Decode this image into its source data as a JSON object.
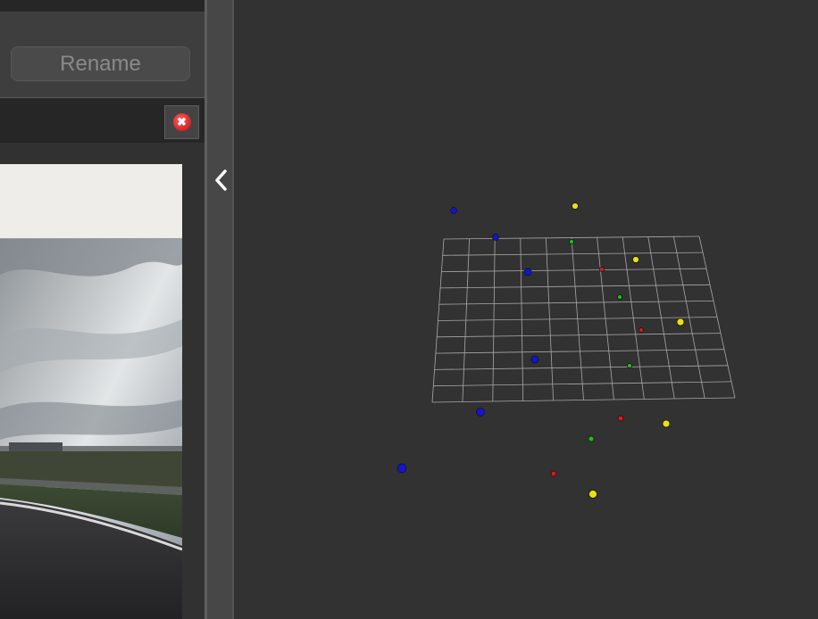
{
  "left_panel": {
    "rename_button_label": "Rename",
    "close_icon_glyph": "✖"
  },
  "splitter": {
    "icon": "chevron-left-icon"
  },
  "scene": {
    "colors": {
      "background": "#323232",
      "grid": "#a8a8a8",
      "blue": "#1414d2",
      "yellow": "#e8e010",
      "green": "#19c119",
      "red": "#d81a1a"
    }
  }
}
